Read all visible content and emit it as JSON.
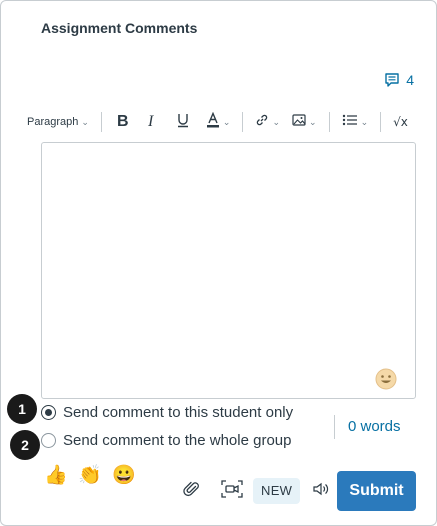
{
  "header": {
    "title": "Assignment Comments"
  },
  "comments": {
    "count": "4",
    "icon": "comment-icon"
  },
  "toolbar": {
    "paragraph_label": "Paragraph",
    "math_label": "√x"
  },
  "editor": {
    "emoji_icon": "smiley-emoji-icon"
  },
  "callouts": [
    "1",
    "2"
  ],
  "send_options": [
    {
      "label": "Send comment to this student only",
      "checked": true
    },
    {
      "label": "Send comment to the whole group",
      "checked": false
    }
  ],
  "word_count": "0 words",
  "quick_emojis": [
    "👍",
    "👏",
    "😀"
  ],
  "actions": {
    "new_label": "NEW",
    "submit_label": "Submit"
  },
  "colors": {
    "accent": "#2b7abc",
    "link": "#0770a3",
    "text": "#2d3b45",
    "badge_bg": "#e6f2f8"
  }
}
